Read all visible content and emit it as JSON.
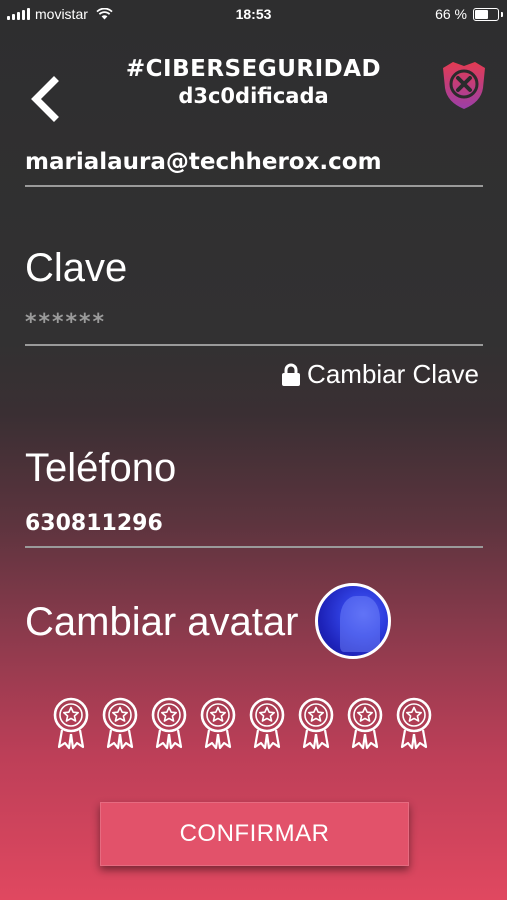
{
  "status_bar": {
    "carrier": "movistar",
    "time": "18:53",
    "battery": "66 %",
    "battery_level": 0.66
  },
  "header": {
    "title_line1": "#CIBERSEGURIDAD",
    "title_line2": "d3c0dificada",
    "back_icon": "chevron-left-icon",
    "logo_icon": "shield-x-logo"
  },
  "account": {
    "email": "marialaura@techherox.com",
    "password_label": "Clave",
    "password_value": "******",
    "change_password": "Cambiar Clave",
    "change_password_icon": "lock-icon",
    "phone_label": "Teléfono",
    "phone_value": "630811296",
    "avatar_label": "Cambiar avatar"
  },
  "badges": {
    "count": 8,
    "icon": "star-medal-icon"
  },
  "confirm_label": "CONFIRMAR",
  "colors": {
    "accent": "#e2526a",
    "background_top": "#2e2e2f",
    "background_bottom": "#e04860",
    "divider": "#9a9a9a"
  }
}
